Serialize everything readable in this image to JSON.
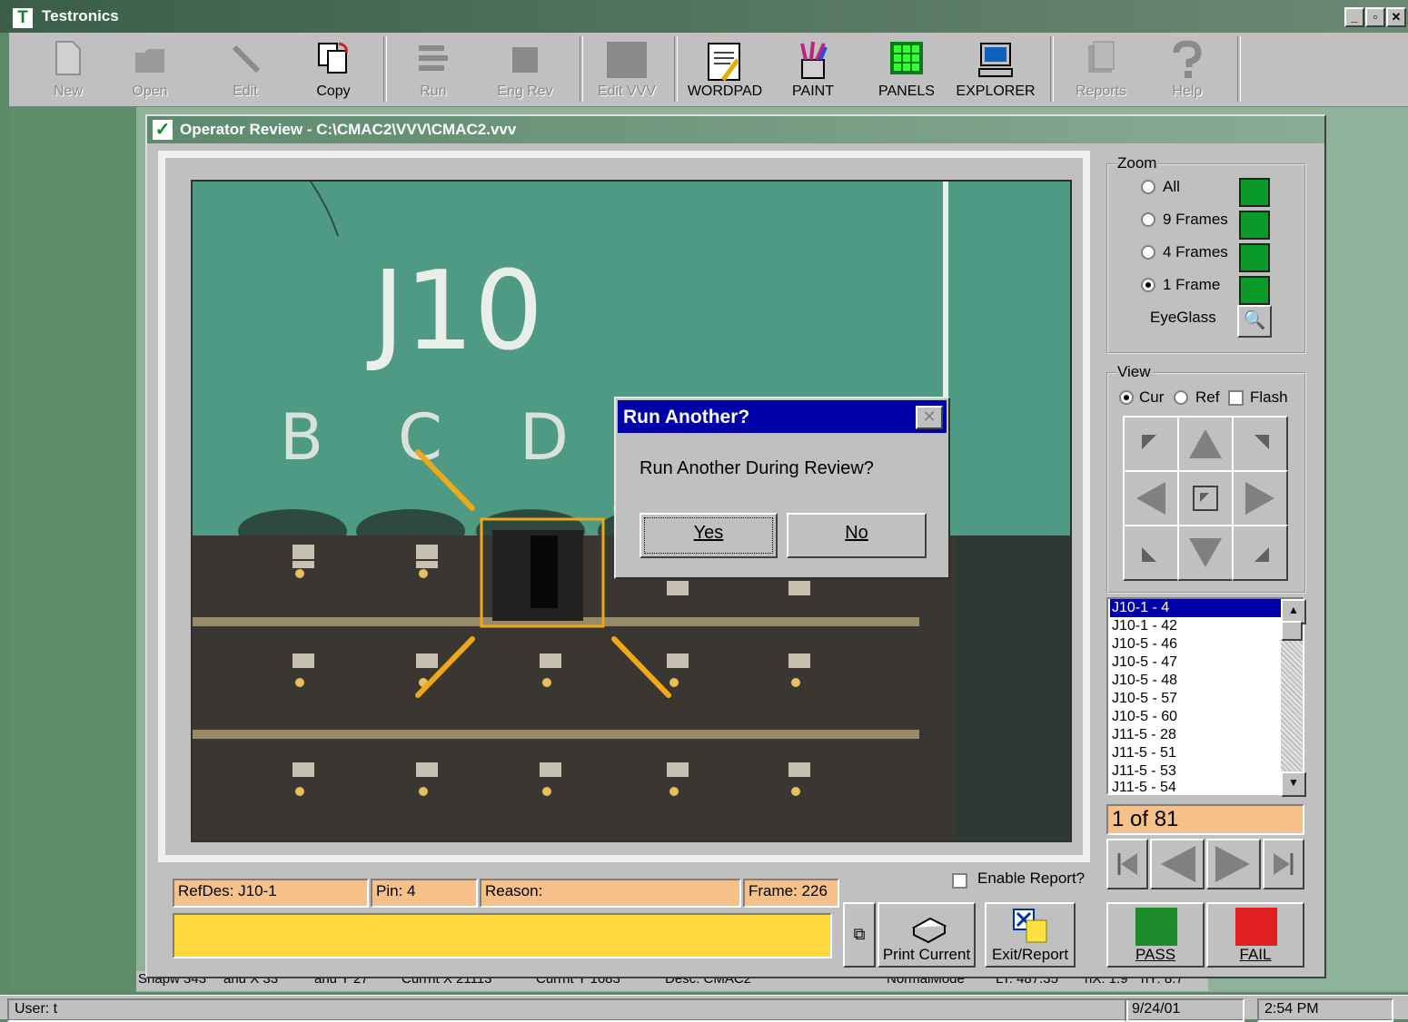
{
  "app": {
    "title": "Testronics",
    "window_buttons": [
      "_",
      "▫",
      "✕"
    ]
  },
  "toolbar": {
    "buttons": [
      {
        "label": "New",
        "icon": "new-document-icon",
        "enabled": false
      },
      {
        "label": "Open",
        "icon": "open-folder-icon",
        "enabled": false
      },
      {
        "label": "Edit",
        "icon": "edit-wand-icon",
        "enabled": false
      },
      {
        "label": "Copy",
        "icon": "copy-icon",
        "enabled": true
      },
      {
        "label": "Run",
        "icon": "run-icon",
        "enabled": false
      },
      {
        "label": "Eng Rev",
        "icon": "eng-rev-icon",
        "enabled": false
      },
      {
        "label": "Edit VVV",
        "icon": "edit-vvv-icon",
        "enabled": false
      },
      {
        "label": "WORDPAD",
        "icon": "wordpad-icon",
        "enabled": true
      },
      {
        "label": "PAINT",
        "icon": "paint-icon",
        "enabled": true
      },
      {
        "label": "PANELS",
        "icon": "panels-icon",
        "enabled": true
      },
      {
        "label": "EXPLORER",
        "icon": "explorer-icon",
        "enabled": true
      },
      {
        "label": "Reports",
        "icon": "reports-icon",
        "enabled": false
      },
      {
        "label": "Help",
        "icon": "help-icon",
        "enabled": false
      }
    ]
  },
  "review_window": {
    "title": "Operator Review - C:\\CMAC2\\VVV\\CMAC2.vvv"
  },
  "board_image": {
    "labels": {
      "ref": "J10",
      "col_b": "B",
      "col_c": "C",
      "col_d": "D"
    }
  },
  "zoom": {
    "label": "Zoom",
    "options": [
      {
        "label": "All",
        "selected": false
      },
      {
        "label": "9 Frames",
        "selected": false
      },
      {
        "label": "4 Frames",
        "selected": false
      },
      {
        "label": "1 Frame",
        "selected": true
      }
    ],
    "eyeglass": "EyeGlass"
  },
  "view": {
    "label": "View",
    "cur": {
      "label": "Cur",
      "selected": true
    },
    "ref": {
      "label": "Ref",
      "selected": false
    },
    "flash": {
      "label": "Flash",
      "checked": false
    }
  },
  "pin_list": {
    "items": [
      "J10-1 - 4",
      "J10-1 - 42",
      "J10-5 - 46",
      "J10-5 - 47",
      "J10-5 - 48",
      "J10-5 - 57",
      "J10-5 - 60",
      "J11-5 - 28",
      "J11-5 - 51",
      "J11-5 - 53",
      "J11-5 - 54"
    ],
    "selected_index": 0
  },
  "counter": "1 of 81",
  "fields": {
    "refdes": "RefDes: J10-1",
    "pin": "Pin: 4",
    "reason": "Reason:",
    "frame": "Frame: 226"
  },
  "enable_report": {
    "label": "Enable Report?",
    "checked": false
  },
  "buttons": {
    "print_current": "Print Current",
    "exit_report": "Exit/Report",
    "pass": "PASS",
    "fail": "FAIL"
  },
  "colors": {
    "pass": "#1a8a2a",
    "fail": "#e02020",
    "field_bg": "#f6c08a",
    "comment_bg": "#ffd840",
    "highlight": "#f0a818",
    "selection": "#0000a8"
  },
  "info_strip": [
    "Snapw 343",
    "anu X 33",
    "anu Y 27",
    "Currnt X 21113",
    "Currnt Y 1683",
    "Desc: CMAC2",
    "NormalMode",
    "LT: 487.35",
    "hX: 1.9",
    "hY: 8.7"
  ],
  "dialog": {
    "title": "Run Another?",
    "message": "Run Another During Review?",
    "yes": "Yes",
    "no": "No"
  },
  "status": {
    "user": "User: t",
    "date": "9/24/01",
    "time": "2:54 PM"
  }
}
